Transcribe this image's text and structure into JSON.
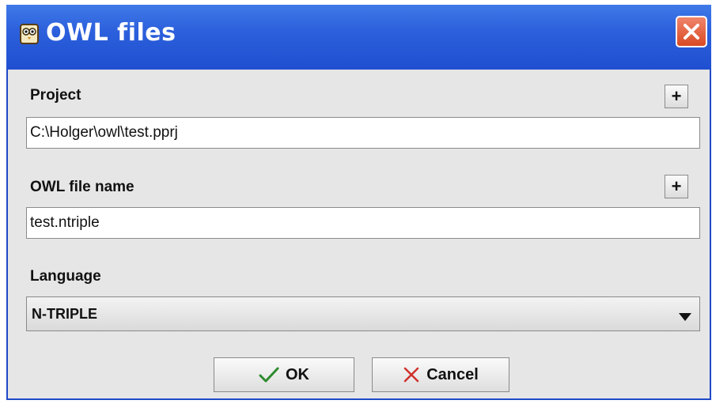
{
  "window": {
    "title": "OWL files",
    "icon": "owl-app-icon",
    "close_icon": "close-icon"
  },
  "project": {
    "label": "Project",
    "value": "C:\\Holger\\owl\\test.pprj",
    "add_button": "+"
  },
  "owl_file": {
    "label": "OWL file name",
    "value": "test.ntriple",
    "add_button": "+"
  },
  "language": {
    "label": "Language",
    "selected": "N-TRIPLE",
    "icon": "chevron-down-icon"
  },
  "buttons": {
    "ok": {
      "label": "OK",
      "icon": "check-icon",
      "icon_color": "#2e8b2e"
    },
    "cancel": {
      "label": "Cancel",
      "icon": "x-icon",
      "icon_color": "#d0302a"
    }
  },
  "colors": {
    "titlebar": "#2c60dc",
    "close_button": "#e05a38",
    "dialog_background": "#e6e6e6"
  }
}
